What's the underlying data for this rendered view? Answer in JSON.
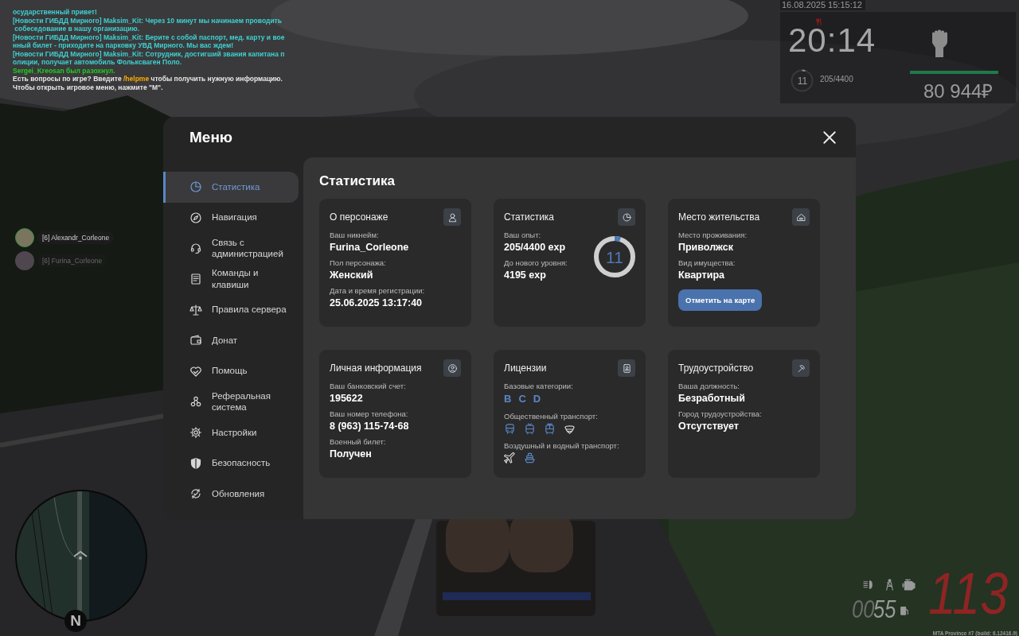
{
  "chat": [
    {
      "parts": [
        {
          "text": "осударственный привет!",
          "color": "#3fd0d0"
        }
      ]
    },
    {
      "parts": [
        {
          "text": "[Новости ГИБДД Мирного] Maksim_Kit: Через 10 минут мы начинаем проводить",
          "color": "#3fd0d0"
        }
      ]
    },
    {
      "parts": [
        {
          "text": " собеседование в нашу организацию.",
          "color": "#3fd0d0"
        }
      ]
    },
    {
      "parts": [
        {
          "text": "[Новости ГИБДД Мирного] Maksim_Kit: Берите с собой паспорт, мед. карту и вое",
          "color": "#3fd0d0"
        }
      ]
    },
    {
      "parts": [
        {
          "text": "нный билет - приходите на парковку УВД Мирного. Мы вас ждем!",
          "color": "#3fd0d0"
        }
      ]
    },
    {
      "parts": [
        {
          "text": "[Новости ГИБДД Мирного] Maksim_Kit: Сотрудник, достигший звания капитана п",
          "color": "#3fd0d0"
        }
      ]
    },
    {
      "parts": [
        {
          "text": "олиции, получает автомобиль Фольксваген Поло.",
          "color": "#3fd0d0"
        }
      ]
    },
    {
      "parts": [
        {
          "text": "Sergei_Kreosan был разохнул.",
          "color": "#22cc22"
        }
      ]
    },
    {
      "parts": [
        {
          "text": "Есть вопросы по игре? Введите ",
          "color": "#e6e6e6"
        },
        {
          "text": "/helpme",
          "color": "#ffaa00"
        },
        {
          "text": " чтобы получить нужную информацию.",
          "color": "#e6e6e6"
        }
      ]
    },
    {
      "parts": [
        {
          "text": "Чтобы открыть игровое меню, нажмите \"M\".",
          "color": "#e6e6e6"
        }
      ]
    }
  ],
  "hud": {
    "date": "16.08.2025 15:15:12",
    "time": "20:14",
    "level": {
      "label": "11",
      "level": 0.05
    },
    "exp": "205/4400",
    "health": {
      "level": 1
    },
    "money": "80 944₽"
  },
  "players": [
    {
      "name": "[6] Alexandr_Corleone",
      "active": true
    },
    {
      "name": "[6] Furina_Corleone",
      "active": false
    }
  ],
  "vehicle": {
    "odometer": "00",
    "fuel": "55",
    "speed": "113",
    "build": "MTA Province #7 (build: 6.12416.9)"
  },
  "minimap": {
    "compass": "N"
  },
  "menu": {
    "title": "Меню",
    "sidebar": [
      {
        "label": "Статистика",
        "selected": true
      },
      {
        "label": "Навигация",
        "selected": false
      },
      {
        "label": "Связь с администрацией",
        "selected": false
      },
      {
        "label": "Команды и клавиши",
        "selected": false
      },
      {
        "label": "Правила сервера",
        "selected": false
      },
      {
        "label": "Донат",
        "selected": false
      },
      {
        "label": "Помощь",
        "selected": false
      },
      {
        "label": "Реферальная система",
        "selected": false
      },
      {
        "label": "Настройки",
        "selected": false
      },
      {
        "label": "Безопасность",
        "selected": false
      },
      {
        "label": "Обновления",
        "selected": false
      }
    ],
    "heading": "Статистика",
    "cards": [
      {
        "kind": "character",
        "title": "О персонаже",
        "fields": [
          {
            "label": "Ваш никнейм:",
            "value": "Furina_Corleone"
          },
          {
            "label": "Пол персонажа:",
            "value": "Женский"
          },
          {
            "label": "Дата и время регистрации:",
            "value": "25.06.2025 13:17:40"
          }
        ]
      },
      {
        "kind": "stats",
        "title": "Статистика",
        "fields": [
          {
            "label": "Ваш опыт:",
            "value": "205/4400 exp"
          },
          {
            "label": "До нового уровня:",
            "value": "4195 exp"
          }
        ],
        "ring": {
          "label": "11",
          "level": 0.05
        }
      },
      {
        "kind": "residence",
        "title": "Место жительства",
        "fields": [
          {
            "label": "Место проживания:",
            "value": "Приволжск"
          },
          {
            "label": "Вид имущества:",
            "value": "Квартира"
          }
        ],
        "button": "Отметить на карте"
      },
      {
        "kind": "personal",
        "title": "Личная информация",
        "fields": [
          {
            "label": "Ваш банковский счет:",
            "value": "195622"
          },
          {
            "label": "Ваш номер телефона:",
            "value": "8 (963) 115-74-68"
          },
          {
            "label": "Военный билет:",
            "value": "Получен"
          }
        ]
      },
      {
        "kind": "licenses",
        "title": "Лицензии",
        "sections": [
          {
            "kind": "letters",
            "label": "Базовые категории:",
            "items": [
              {
                "text": "B",
                "owned": true
              },
              {
                "text": "C",
                "owned": true
              },
              {
                "text": "D",
                "owned": true
              }
            ]
          },
          {
            "kind": "icons",
            "label": "Общественный транспорт:",
            "items": [
              {
                "owned": true
              },
              {
                "owned": true
              },
              {
                "owned": true
              },
              {
                "owned": false
              }
            ]
          },
          {
            "kind": "icons",
            "label": "Воздушный и водный транспорт:",
            "items": [
              {
                "owned": false
              },
              {
                "owned": true
              }
            ]
          }
        ]
      },
      {
        "kind": "job",
        "title": "Трудоустройство",
        "fields": [
          {
            "label": "Ваша должность:",
            "value": "Безработный"
          },
          {
            "label": "Город трудоустройства:",
            "value": "Отсутствует"
          }
        ]
      }
    ]
  }
}
